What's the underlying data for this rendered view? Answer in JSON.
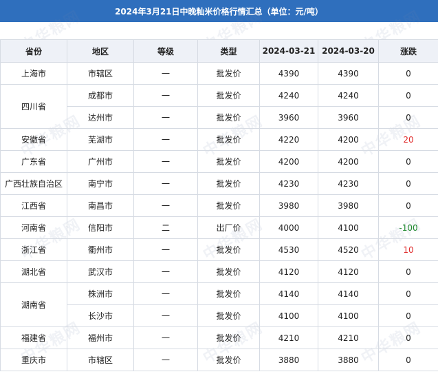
{
  "header": {
    "title": "2024年3月21日中晚籼米价格行情汇总（单位：元/吨）"
  },
  "watermark": "中华粮网",
  "columns": [
    "省份",
    "地区",
    "等级",
    "类型",
    "2024-03-21",
    "2024-03-20",
    "涨跌"
  ],
  "rows": [
    [
      "上海市",
      "市辖区",
      "一",
      "批发价",
      "4390",
      "4390",
      "0"
    ],
    [
      "四川省",
      "成都市",
      "一",
      "批发价",
      "4240",
      "4240",
      "0"
    ],
    [
      "",
      "达州市",
      "一",
      "批发价",
      "3960",
      "3960",
      "0"
    ],
    [
      "安徽省",
      "芜湖市",
      "一",
      "批发价",
      "4220",
      "4200",
      "20"
    ],
    [
      "广东省",
      "广州市",
      "一",
      "批发价",
      "4200",
      "4200",
      "0"
    ],
    [
      "广西壮族自治区",
      "南宁市",
      "一",
      "批发价",
      "4230",
      "4230",
      "0"
    ],
    [
      "江西省",
      "南昌市",
      "一",
      "批发价",
      "3980",
      "3980",
      "0"
    ],
    [
      "河南省",
      "信阳市",
      "二",
      "出厂价",
      "4000",
      "4100",
      "-100"
    ],
    [
      "浙江省",
      "衢州市",
      "一",
      "批发价",
      "4530",
      "4520",
      "10"
    ],
    [
      "湖北省",
      "武汉市",
      "一",
      "批发价",
      "4120",
      "4120",
      "0"
    ],
    [
      "湖南省",
      "株洲市",
      "一",
      "批发价",
      "4140",
      "4140",
      "0"
    ],
    [
      "",
      "长沙市",
      "一",
      "批发价",
      "4100",
      "4100",
      "0"
    ],
    [
      "福建省",
      "福州市",
      "一",
      "批发价",
      "4210",
      "4210",
      "0"
    ],
    [
      "重庆市",
      "市辖区",
      "一",
      "批发价",
      "3880",
      "3880",
      "0"
    ]
  ]
}
